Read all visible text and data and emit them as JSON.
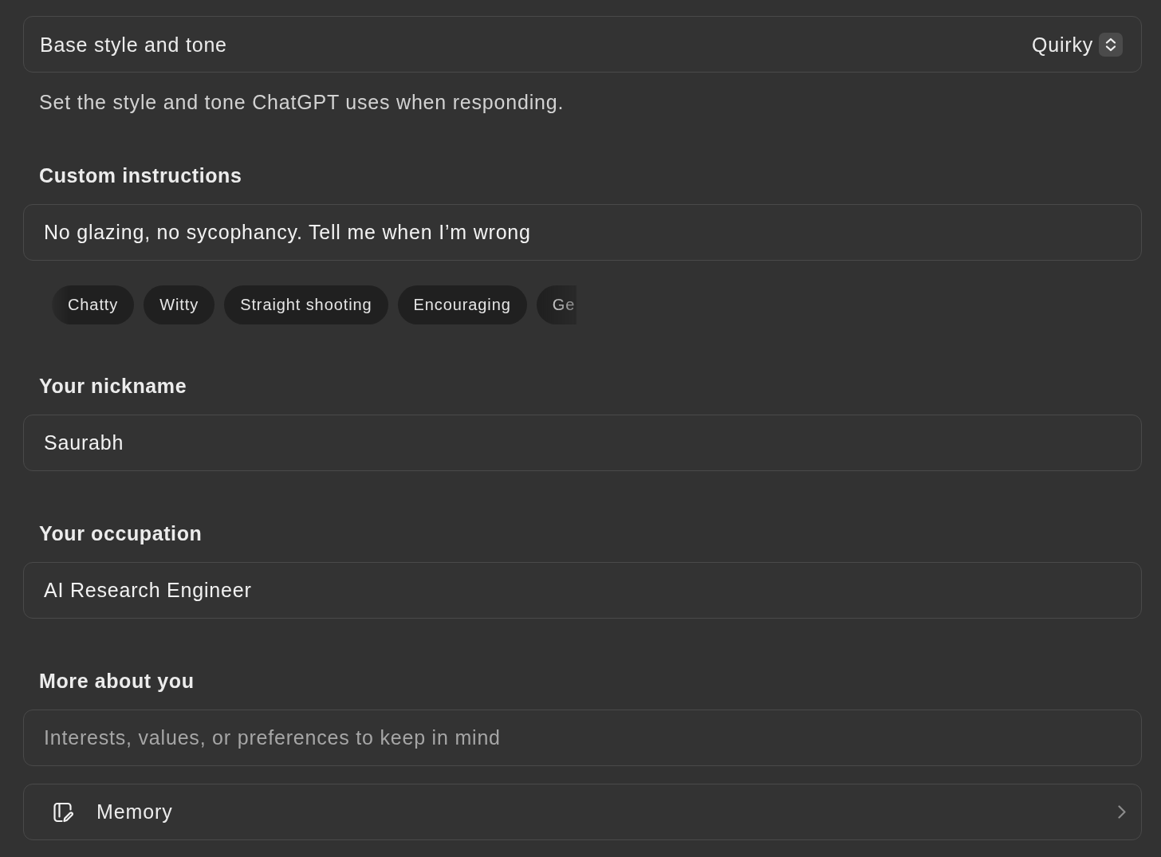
{
  "base_style": {
    "label": "Base style and tone",
    "value": "Quirky"
  },
  "description": "Set the style and tone ChatGPT uses when responding.",
  "custom_instructions": {
    "heading": "Custom instructions",
    "value": "No glazing, no sycophancy. Tell me when I’m wrong",
    "suggestions": [
      "Chatty",
      "Witty",
      "Straight shooting",
      "Encouraging",
      "Ge"
    ]
  },
  "fields": [
    {
      "heading": "Your nickname",
      "value": "Saurabh"
    },
    {
      "heading": "Your occupation",
      "value": "AI Research Engineer"
    },
    {
      "heading": "More about you",
      "placeholder": "Interests, values, or preferences to keep in mind"
    }
  ],
  "memory": {
    "label": "Memory"
  }
}
